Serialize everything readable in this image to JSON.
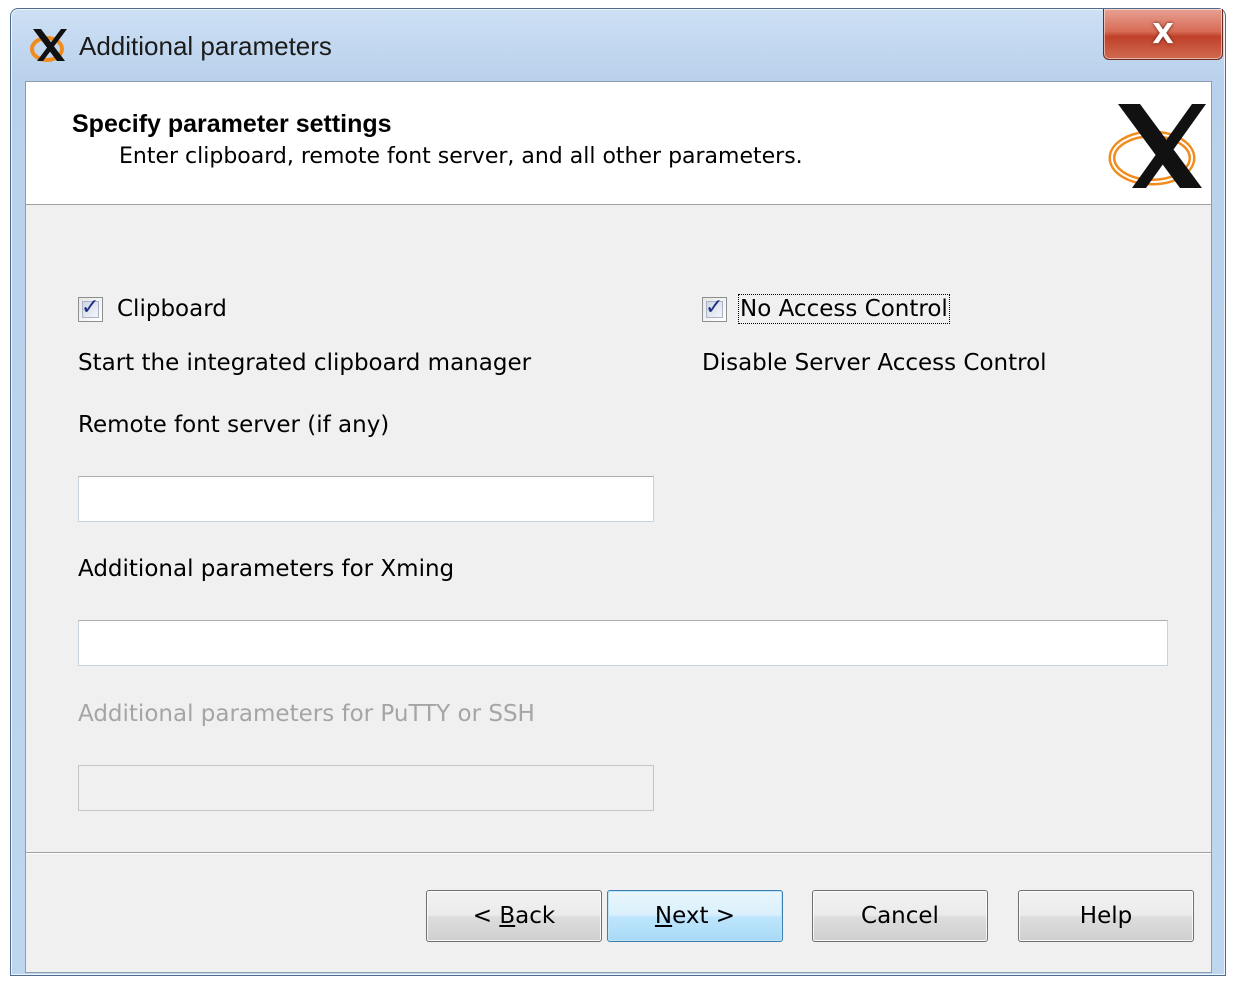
{
  "window": {
    "title": "Additional parameters",
    "close_glyph": "X"
  },
  "header": {
    "title": "Specify parameter settings",
    "subtitle": "Enter clipboard, remote font server, and all other parameters.",
    "logo_icon": "xming-x-logo-icon"
  },
  "options": {
    "clipboard": {
      "label": "Clipboard",
      "checked": true,
      "description": "Start the integrated clipboard manager"
    },
    "no_access_control": {
      "label": "No Access Control",
      "checked": true,
      "description": "Disable Server Access Control"
    }
  },
  "fields": {
    "font_server": {
      "label": "Remote font server (if any)",
      "value": ""
    },
    "xming_params": {
      "label": "Additional parameters for Xming",
      "value": ""
    },
    "ssh_params": {
      "label": "Additional parameters for PuTTY or SSH",
      "value": "",
      "disabled": true
    }
  },
  "buttons": {
    "back": {
      "prefix": "< ",
      "mnemonic": "B",
      "rest": "ack"
    },
    "next": {
      "prefix": "",
      "mnemonic": "N",
      "rest": "ext >"
    },
    "cancel": "Cancel",
    "help": "Help"
  },
  "colors": {
    "checkmark": "#1c2f85",
    "default_button_border": "#3c7fb1",
    "logo_orange": "#f08c1e"
  }
}
